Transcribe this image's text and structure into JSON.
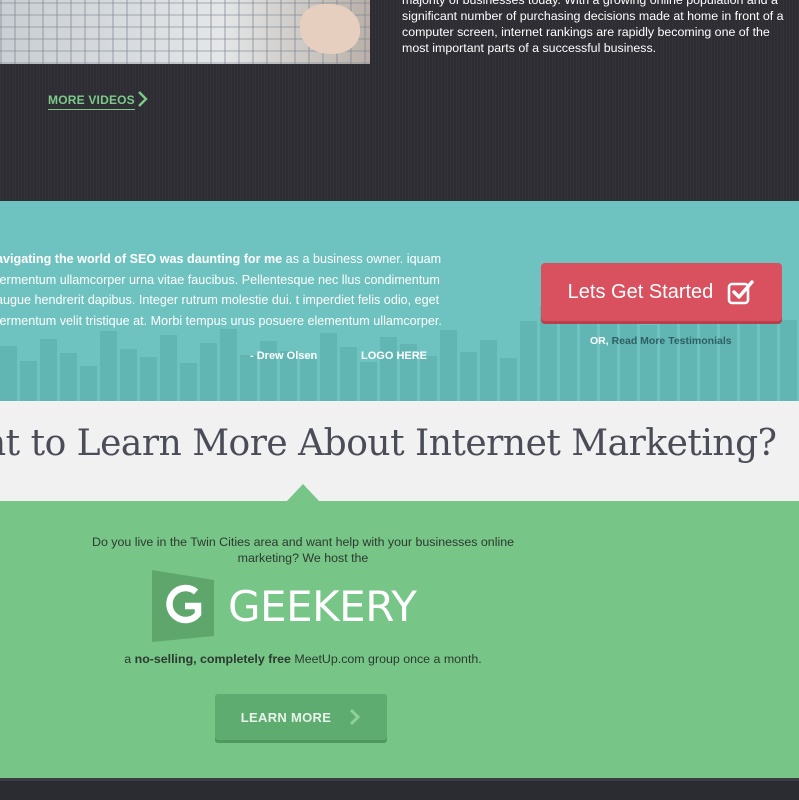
{
  "video_section": {
    "description": "majority of businesses today. With a growing online population and a significant number of purchasing decisions made at home in front of a computer screen, internet rankings are rapidly becoming one of the most important parts of a successful business.",
    "more_videos_label": "MORE VIDEOS"
  },
  "testimonial_section": {
    "quote_bold": "avigating the world of SEO was daunting for me",
    "quote_rest": " as a business owner. iquam fermentum ullamcorper urna vitae faucibus. Pellentesque nec llus condimentum augue hendrerit dapibus. Integer rutrum molestie dui. t imperdiet felis odio, eget fermentum velit tristique at. Morbi tempus urus posuere elementum ullamcorper.",
    "author": "- Drew Olsen",
    "logo_placeholder": "LOGO HERE",
    "cta_label": "Lets Get Started",
    "or_label": "OR,",
    "testimonials_link": "Read More Testimonials",
    "colors": {
      "background": "#6ec3c0",
      "cta": "#d9505e"
    }
  },
  "learn_more_section": {
    "headline": "nt to Learn More About Internet Marketing?"
  },
  "meetup_section": {
    "intro": "Do you live in the Twin Cities area and want help with your businesses online marketing? We host the",
    "logo_text": "GEEKERY",
    "line_prefix": "a ",
    "line_bold": "no-selling, completely free",
    "line_suffix": " MeetUp.com group once a month.",
    "button_label": "LEARN MORE",
    "colors": {
      "background": "#78c588",
      "button": "#5eac70"
    }
  }
}
